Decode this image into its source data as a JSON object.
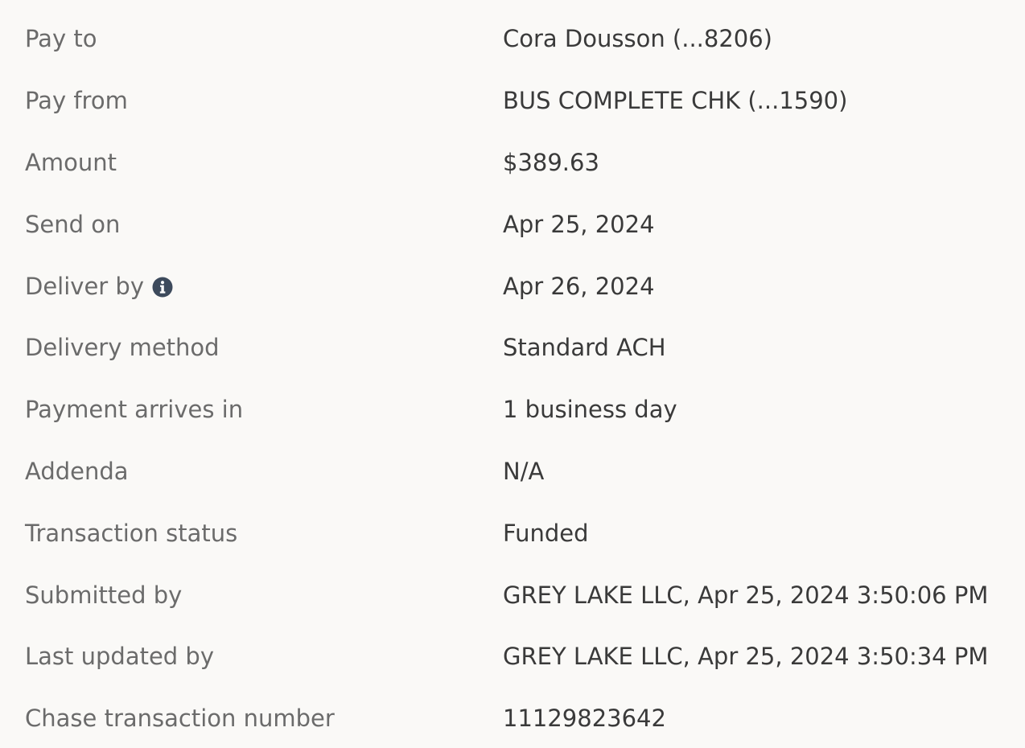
{
  "payment_details": {
    "rows": [
      {
        "label": "Pay to",
        "value": "Cora Dousson (...8206)"
      },
      {
        "label": "Pay from",
        "value": "BUS COMPLETE CHK (...1590)"
      },
      {
        "label": "Amount",
        "value": "$389.63"
      },
      {
        "label": "Send on",
        "value": "Apr 25, 2024"
      },
      {
        "label": "Deliver by",
        "value": "Apr 26, 2024",
        "icon": "info-icon"
      },
      {
        "label": "Delivery method",
        "value": "Standard ACH"
      },
      {
        "label": "Payment arrives in",
        "value": "1 business day"
      },
      {
        "label": "Addenda",
        "value": "N/A"
      },
      {
        "label": "Transaction status",
        "value": "Funded"
      },
      {
        "label": "Submitted by",
        "value": "GREY LAKE LLC, Apr 25, 2024 3:50:06 PM"
      },
      {
        "label": "Last updated by",
        "value": "GREY LAKE LLC, Apr 25, 2024 3:50:34 PM"
      },
      {
        "label": "Chase transaction number",
        "value": "11129823642"
      }
    ]
  },
  "colors": {
    "background": "#faf9f7",
    "label_text": "#6b6b6b",
    "value_text": "#3a3a3a",
    "info_icon": "#3d4a5c"
  }
}
